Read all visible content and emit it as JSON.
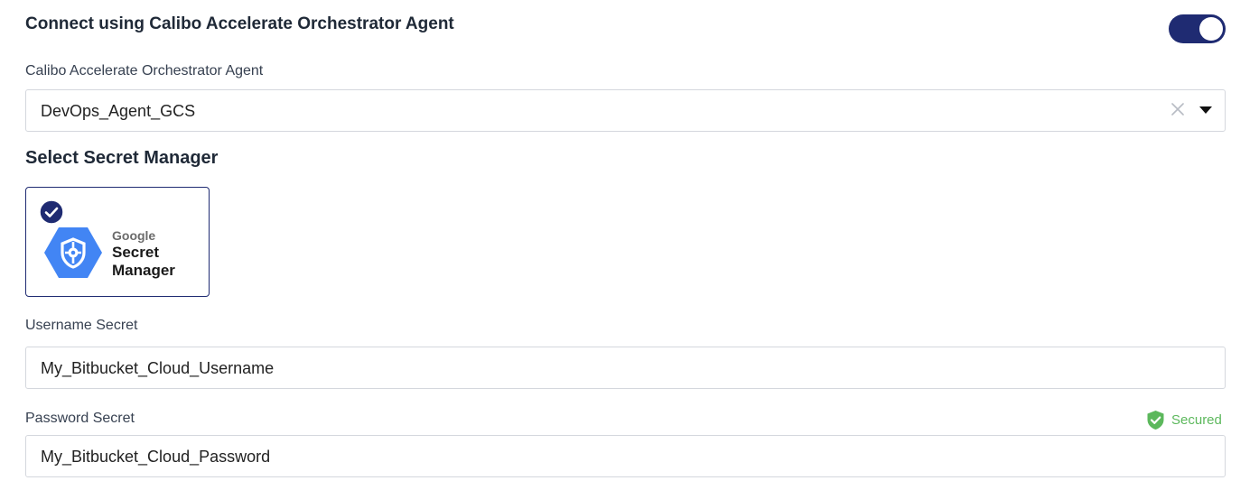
{
  "header": {
    "title": "Connect using Calibo Accelerate Orchestrator Agent",
    "toggle_on": true,
    "toggle_color": "#1f2b72"
  },
  "agent_field": {
    "label": "Calibo Accelerate Orchestrator Agent",
    "value": "DevOps_Agent_GCS",
    "clear_icon": "close-icon",
    "dropdown_icon": "caret-down-icon"
  },
  "secret_manager": {
    "title": "Select Secret Manager",
    "option": {
      "brand_small": "Google",
      "brand_name": "Secret Manager",
      "selected": true,
      "icon": "google-secret-manager-icon",
      "accent": "#4285f4"
    }
  },
  "username_field": {
    "label": "Username Secret",
    "value": "My_Bitbucket_Cloud_Username"
  },
  "password_field": {
    "label": "Password Secret",
    "value": "My_Bitbucket_Cloud_Password",
    "status": "Secured",
    "status_icon": "shield-check-icon",
    "status_color": "#5cb85c"
  }
}
